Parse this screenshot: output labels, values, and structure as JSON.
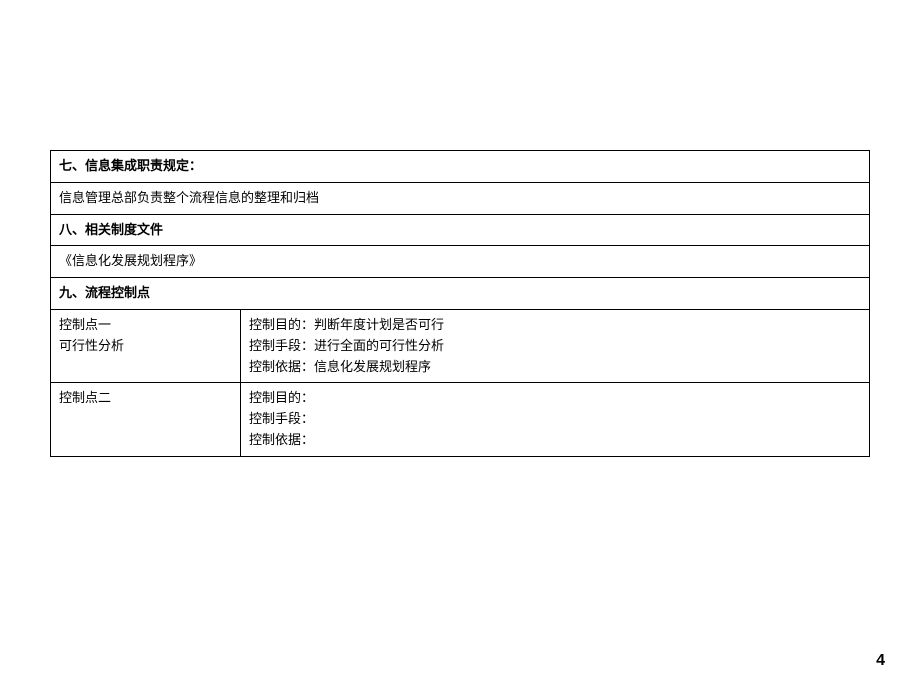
{
  "sections": {
    "s7": {
      "title": "七、信息集成职责规定：",
      "content": "信息管理总部负责整个流程信息的整理和归档"
    },
    "s8": {
      "title": "八、相关制度文件",
      "content": "《信息化发展规划程序》"
    },
    "s9": {
      "title": "九、流程控制点",
      "rows": [
        {
          "left": "控制点一\n可行性分析",
          "right": "控制目的：判断年度计划是否可行\n控制手段：进行全面的可行性分析\n控制依据：信息化发展规划程序"
        },
        {
          "left": "控制点二",
          "right": "控制目的：\n控制手段：\n控制依据："
        }
      ]
    }
  },
  "pageNumber": "4"
}
